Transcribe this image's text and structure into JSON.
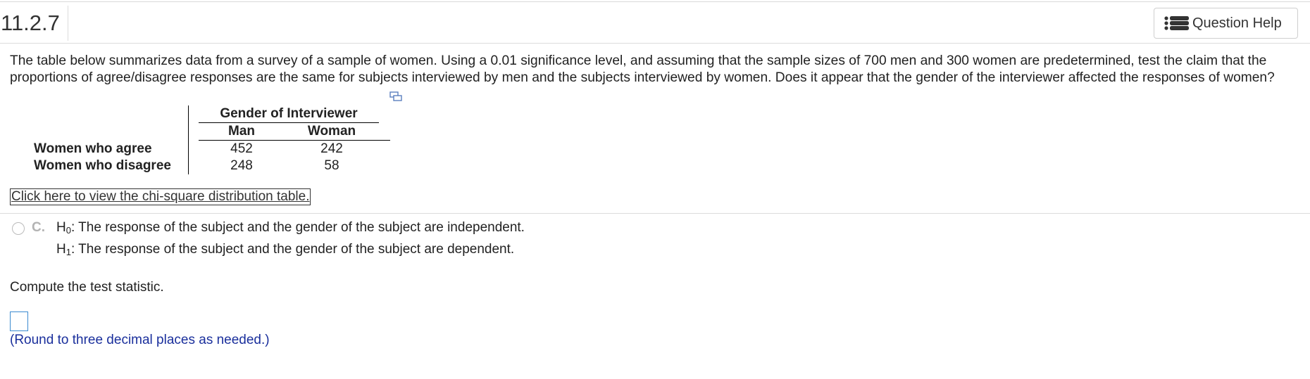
{
  "question_number": "11.2.7",
  "help_button": {
    "label": "Question Help",
    "icon": "list-icon"
  },
  "prompt": "The table below summarizes data from a survey of a sample of women. Using a 0.01 significance level, and assuming that the sample sizes of 700 men and 300 women are predetermined, test the claim that the proportions of agree/disagree responses are the same for subjects interviewed by men and the subjects interviewed by women. Does it appear that the gender of the interviewer affected the responses of women?",
  "table": {
    "group_header": "Gender of Interviewer",
    "columns": [
      "Man",
      "Woman"
    ],
    "rows": [
      {
        "label": "Women who agree",
        "values": [
          "452",
          "242"
        ]
      },
      {
        "label": "Women who disagree",
        "values": [
          "248",
          "58"
        ]
      }
    ]
  },
  "chi_square_link": "Click here to view the chi-square distribution table.",
  "option": {
    "letter": "C.",
    "h0_text": ": The response of the subject and the gender of the subject are independent.",
    "h1_text": ": The response of the subject and the gender of the subject are dependent."
  },
  "compute_prompt": "Compute the test statistic.",
  "answer_hint": "(Round to three decimal places as needed.)"
}
